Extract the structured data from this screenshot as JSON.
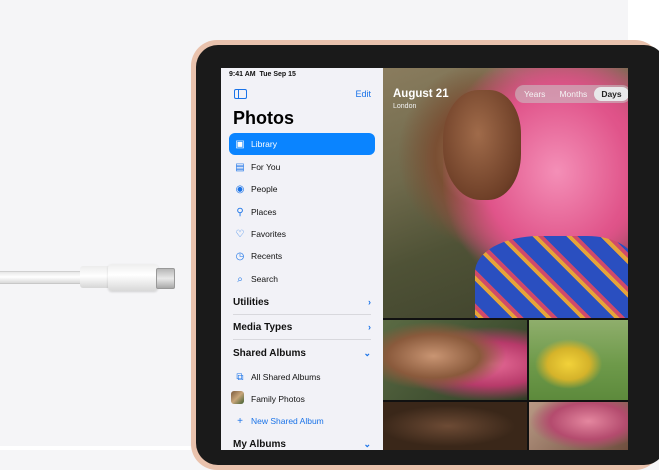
{
  "status_bar": {
    "time": "9:41 AM",
    "date": "Tue Sep 15"
  },
  "sidebar": {
    "edit_label": "Edit",
    "title": "Photos",
    "items": [
      {
        "label": "Library",
        "icon": "library-icon",
        "active": true
      },
      {
        "label": "For You",
        "icon": "for-you-icon"
      },
      {
        "label": "People",
        "icon": "people-icon"
      },
      {
        "label": "Places",
        "icon": "places-icon"
      },
      {
        "label": "Favorites",
        "icon": "heart-icon"
      },
      {
        "label": "Recents",
        "icon": "clock-icon"
      },
      {
        "label": "Search",
        "icon": "search-icon"
      }
    ],
    "sections": [
      {
        "label": "Utilities",
        "chevron": "chevron-right-icon"
      },
      {
        "label": "Media Types",
        "chevron": "chevron-right-icon"
      },
      {
        "label": "Shared Albums",
        "chevron": "chevron-down-icon"
      }
    ],
    "shared_albums": [
      {
        "label": "All Shared Albums",
        "icon": "shared-albums-icon"
      },
      {
        "label": "Family Photos",
        "icon": "album-thumbnail"
      },
      {
        "label": "New Shared Album",
        "icon": "plus-icon"
      }
    ],
    "my_albums_label": "My Albums"
  },
  "main": {
    "date_title": "August 21",
    "location": "London",
    "segments": [
      {
        "label": "Years"
      },
      {
        "label": "Months"
      },
      {
        "label": "Days",
        "selected": true
      }
    ]
  },
  "colors": {
    "accent": "#0a84ff",
    "device_frame": "#e9c2ad"
  }
}
